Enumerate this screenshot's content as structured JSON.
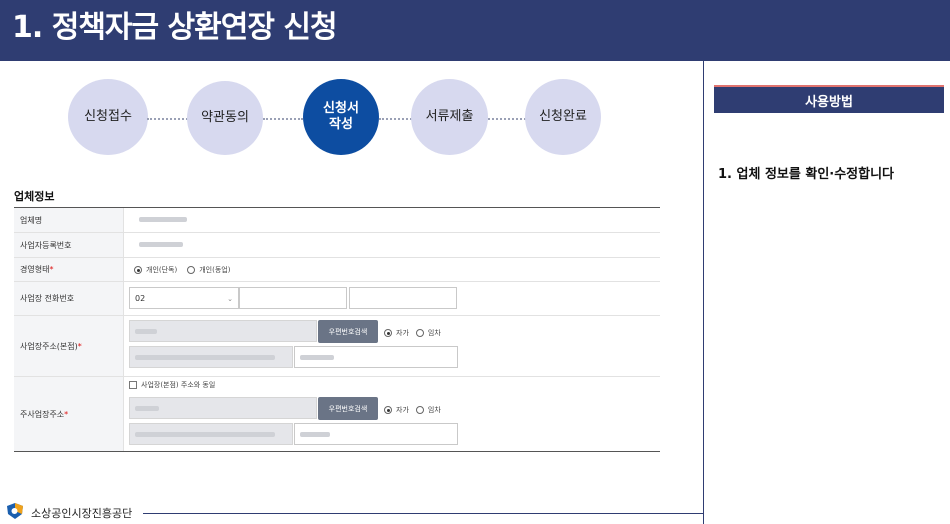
{
  "header": {
    "title": "1. 정책자금 상환연장 신청"
  },
  "steps": [
    {
      "label": "신청접수",
      "active": false
    },
    {
      "label": "약관동의",
      "active": false
    },
    {
      "label": "신청서\n작성",
      "active": true
    },
    {
      "label": "서류제출",
      "active": false
    },
    {
      "label": "신청완료",
      "active": false
    }
  ],
  "section": {
    "title": "업체정보"
  },
  "form": {
    "company_name": {
      "label": "업체명"
    },
    "business_number": {
      "label": "사업자등록번호"
    },
    "management_type": {
      "label": "경영형태",
      "required": "*",
      "options": [
        "개인(단독)",
        "개인(동업)"
      ],
      "selected": "개인(단독)"
    },
    "business_phone": {
      "label": "사업장 전화번호",
      "area_code": "02"
    },
    "business_address": {
      "label": "사업장주소(본점)",
      "required": "*",
      "zip_button": "우편번호검색",
      "ownership_options": [
        "자가",
        "임차"
      ],
      "ownership_selected": "자가"
    },
    "main_address": {
      "label": "주사업장주소",
      "required": "*",
      "same_as_checkbox": "사업장(본점) 주소와 동일",
      "zip_button": "우편번호검색",
      "ownership_options": [
        "자가",
        "임차"
      ],
      "ownership_selected": "자가"
    }
  },
  "right_panel": {
    "title": "사용방법",
    "instruction": "1. 업체 정보를 확인·수정합니다"
  },
  "footer": {
    "org_name": "소상공인시장진흥공단"
  },
  "colors": {
    "brand": "#2f3d72",
    "active_step": "#0d4da1",
    "step": "#d7d9ef",
    "accent": "#e0736f"
  }
}
